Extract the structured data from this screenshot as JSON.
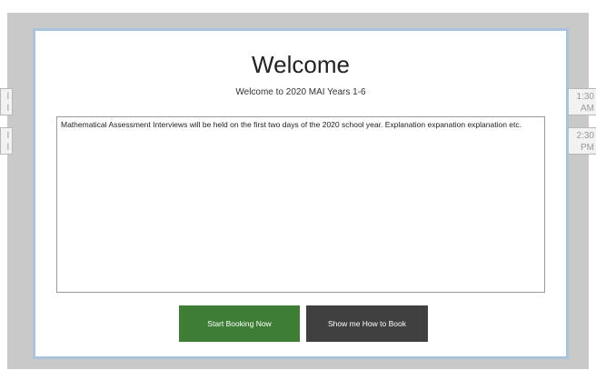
{
  "background_slots": {
    "left": [
      {
        "line1": "l",
        "line2": "l"
      },
      {
        "line1": "l",
        "line2": "l"
      }
    ],
    "right": [
      {
        "line1": "1:30",
        "line2": "AM"
      },
      {
        "line1": "2:30",
        "line2": "PM"
      }
    ]
  },
  "modal": {
    "title": "Welcome",
    "subtitle": "Welcome to 2020 MAI Years 1-6",
    "message": "Mathematical Assessment Interviews will be held on the first two days of the 2020 school year. Explanation expanation explanation etc.",
    "buttons": {
      "start_label": "Start Booking Now",
      "howto_label": "Show me How to Book"
    }
  },
  "colors": {
    "start_button": "#3e7d36",
    "howto_button": "#404040",
    "modal_border": "#a9c3dd",
    "backdrop": "#c9c9c9"
  }
}
